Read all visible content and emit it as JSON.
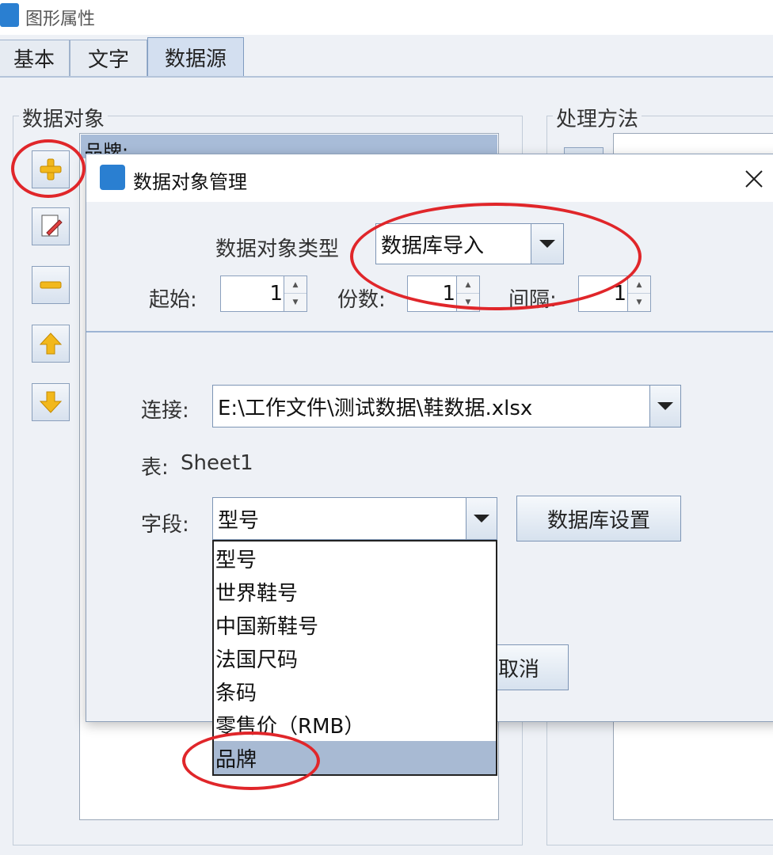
{
  "window": {
    "title": "图形属性",
    "tabs": [
      "基本",
      "文字",
      "数据源"
    ]
  },
  "groups": {
    "objects_title": "数据对象",
    "method_title": "处理方法",
    "objects_list_first": "品牌:"
  },
  "dialog": {
    "title": "数据对象管理",
    "type_label": "数据对象类型",
    "type_value": "数据库导入",
    "start_label": "起始:",
    "start_value": "1",
    "copies_label": "份数:",
    "copies_value": "1",
    "interval_label": "间隔:",
    "interval_value": "1",
    "connection_label": "连接:",
    "connection_value": "E:\\工作文件\\测试数据\\鞋数据.xlsx",
    "table_label": "表:",
    "table_value": "Sheet1",
    "field_label": "字段:",
    "field_value": "型号",
    "db_settings_button": "数据库设置",
    "cancel_button": "取消",
    "field_options": [
      "型号",
      "世界鞋号",
      "中国新鞋号",
      "法国尺码",
      "条码",
      "零售价（RMB）",
      "品牌"
    ],
    "field_options_selected": "品牌"
  },
  "colors": {
    "annotation": "#e0262a",
    "selection": "#a8bad3"
  }
}
